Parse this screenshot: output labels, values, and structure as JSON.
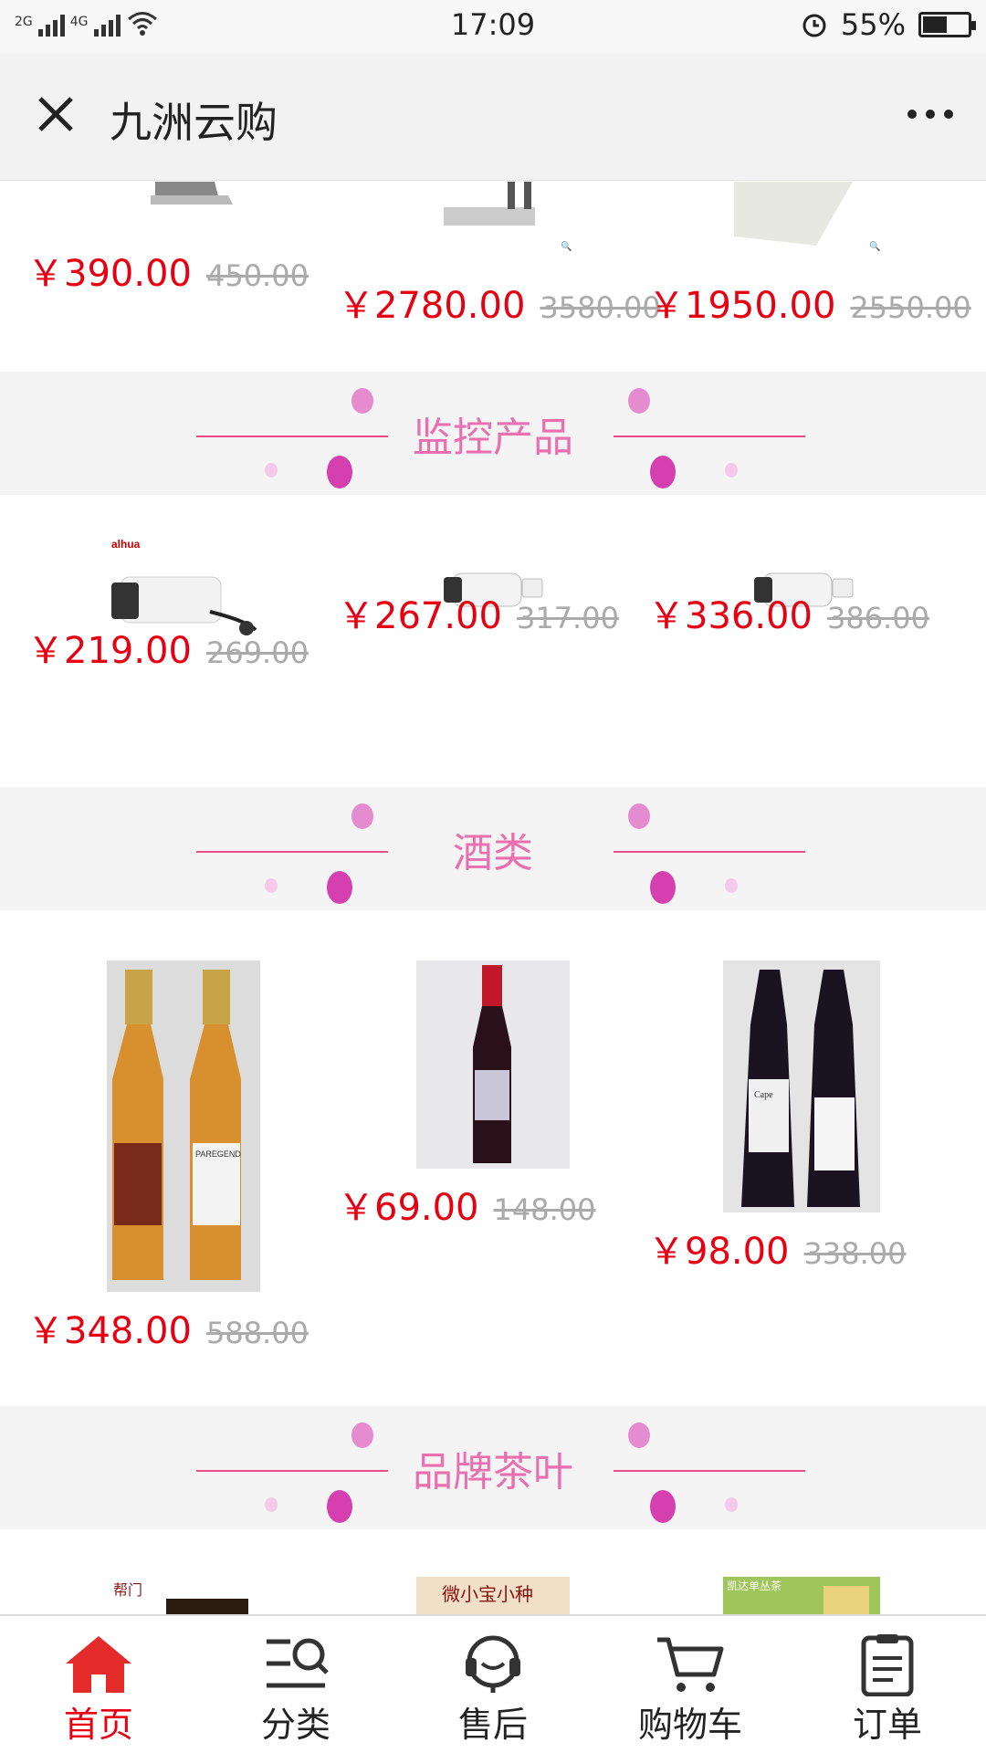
{
  "status_bar": {
    "net1": "2G",
    "net2": "4G",
    "time": "17:09",
    "battery": "55%"
  },
  "header": {
    "title": "九洲云购"
  },
  "top_row": [
    {
      "price": "￥390.00",
      "old_price": "450.00"
    },
    {
      "price": "￥2780.00",
      "old_price": "3580.00"
    },
    {
      "price": "￥1950.00",
      "old_price": "2550.00"
    }
  ],
  "sections": [
    {
      "title": "监控产品",
      "products": [
        {
          "price": "￥219.00",
          "old_price": "269.00",
          "brand": "alhua"
        },
        {
          "price": "￥267.00",
          "old_price": "317.00"
        },
        {
          "price": "￥336.00",
          "old_price": "386.00"
        }
      ]
    },
    {
      "title": "酒类",
      "products": [
        {
          "price": "￥348.00",
          "old_price": "588.00",
          "label": "PAREGEND"
        },
        {
          "price": "￥69.00",
          "old_price": "148.00"
        },
        {
          "price": "￥98.00",
          "old_price": "338.00",
          "label": "Cape"
        }
      ]
    },
    {
      "title": "品牌茶叶",
      "products": [
        {
          "label": "帮门"
        },
        {
          "label": "微小宝小种"
        },
        {
          "label": "凯达单丛茶"
        }
      ]
    }
  ],
  "tabs": [
    {
      "label": "首页",
      "icon": "home-icon"
    },
    {
      "label": "分类",
      "icon": "category-icon"
    },
    {
      "label": "售后",
      "icon": "customer-service-icon"
    },
    {
      "label": "购物车",
      "icon": "cart-icon"
    },
    {
      "label": "订单",
      "icon": "order-icon"
    }
  ],
  "colors": {
    "accent": "#e60012",
    "section_title": "#e96fae",
    "section_line": "#ec4c86"
  }
}
